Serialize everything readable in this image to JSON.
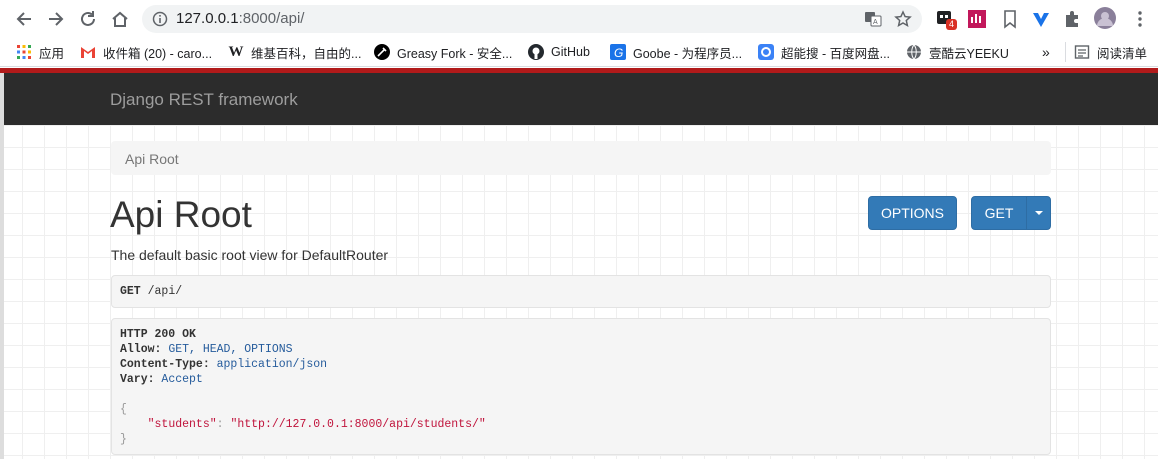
{
  "browser": {
    "url_host": "127.0.0.1",
    "url_rest": ":8000/api/",
    "extension_badge": "4"
  },
  "bookmarks": {
    "items": [
      {
        "label": "应用",
        "icon": "apps-grid-icon"
      },
      {
        "label": "收件箱 (20) - caro...",
        "icon": "gmail-icon"
      },
      {
        "label": "维基百科，自由的...",
        "icon": "wikipedia-icon"
      },
      {
        "label": "Greasy Fork - 安全...",
        "icon": "greasyfork-icon"
      },
      {
        "label": "GitHub",
        "icon": "github-icon"
      },
      {
        "label": "Goobe - 为程序员...",
        "icon": "goobe-icon"
      },
      {
        "label": "超能搜 - 百度网盘...",
        "icon": "search-engine-icon"
      },
      {
        "label": "壹酷云YEEKU",
        "icon": "globe-icon"
      }
    ],
    "overflow": "»",
    "reading_list": "阅读清单"
  },
  "navbar": {
    "brand": "Django REST framework"
  },
  "breadcrumb": {
    "item": "Api Root"
  },
  "content": {
    "title": "Api Root",
    "description": "The default basic root view for DefaultRouter",
    "options_button": "OPTIONS",
    "get_button": "GET"
  },
  "request": {
    "method": "GET",
    "path": "/api/"
  },
  "response": {
    "status": "HTTP 200 OK",
    "headers": [
      {
        "key": "Allow:",
        "value": "GET, HEAD, OPTIONS"
      },
      {
        "key": "Content-Type:",
        "value": "application/json"
      },
      {
        "key": "Vary:",
        "value": "Accept"
      }
    ],
    "open_brace": "{",
    "body_key": "\"students\"",
    "body_sep": ": ",
    "body_value": "\"http://127.0.0.1:8000/api/students/\"",
    "close_brace": "}"
  },
  "colors": {
    "navbar_bg": "#2c2c2c",
    "button_primary": "#337ab7",
    "accent_red": "#b11a1a",
    "json_string": "#c0143c",
    "header_value": "#265c9c"
  }
}
